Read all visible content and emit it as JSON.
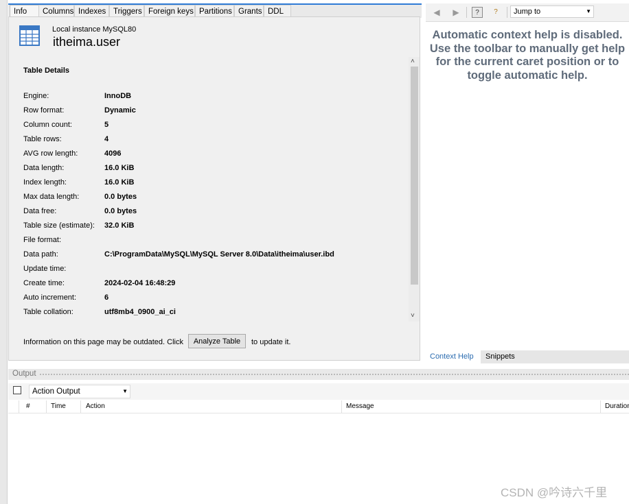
{
  "tabs": [
    {
      "label": "Info",
      "active": true
    },
    {
      "label": "Columns"
    },
    {
      "label": "Indexes"
    },
    {
      "label": "Triggers"
    },
    {
      "label": "Foreign keys"
    },
    {
      "label": "Partitions"
    },
    {
      "label": "Grants"
    },
    {
      "label": "DDL"
    }
  ],
  "info": {
    "instance": "Local instance MySQL80",
    "table_name": "itheima.user",
    "details_title": "Table Details",
    "rows": [
      {
        "label": "Engine:",
        "value": "InnoDB"
      },
      {
        "label": "Row format:",
        "value": "Dynamic"
      },
      {
        "label": "Column count:",
        "value": "5"
      },
      {
        "label": "Table rows:",
        "value": "4"
      },
      {
        "label": "AVG row length:",
        "value": "4096"
      },
      {
        "label": "Data length:",
        "value": "16.0 KiB"
      },
      {
        "label": "Index length:",
        "value": "16.0 KiB"
      },
      {
        "label": "Max data length:",
        "value": "0.0 bytes"
      },
      {
        "label": "Data free:",
        "value": "0.0 bytes"
      },
      {
        "label": "Table size (estimate):",
        "value": "32.0 KiB"
      },
      {
        "label": "File format:",
        "value": ""
      },
      {
        "label": "Data path:",
        "value": "C:\\ProgramData\\MySQL\\MySQL Server 8.0\\Data\\itheima\\user.ibd"
      },
      {
        "label": "Update time:",
        "value": ""
      },
      {
        "label": "Create time:",
        "value": "2024-02-04 16:48:29"
      },
      {
        "label": "Auto increment:",
        "value": "6"
      },
      {
        "label": "Table collation:",
        "value": "utf8mb4_0900_ai_ci"
      }
    ],
    "note": "Information on this page may be outdated. Click",
    "analyze_label": "Analyze Table",
    "update_note": "to update it."
  },
  "right_panel": {
    "jump_to": "Jump to",
    "help_text": "Automatic context help is disabled. Use the toolbar to manually get help for the current caret position or to toggle automatic help.",
    "tabs": [
      {
        "label": "Context Help",
        "active": true
      },
      {
        "label": "Snippets"
      }
    ]
  },
  "output": {
    "title": "Output",
    "selector": "Action Output",
    "columns": [
      "#",
      "Time",
      "Action",
      "Message",
      "Duration"
    ]
  },
  "watermark": "CSDN @吟诗六千里",
  "colors": {
    "accent": "#2e7bd6",
    "help_text": "#5f6b7a",
    "link_tab": "#2b6cb0"
  }
}
